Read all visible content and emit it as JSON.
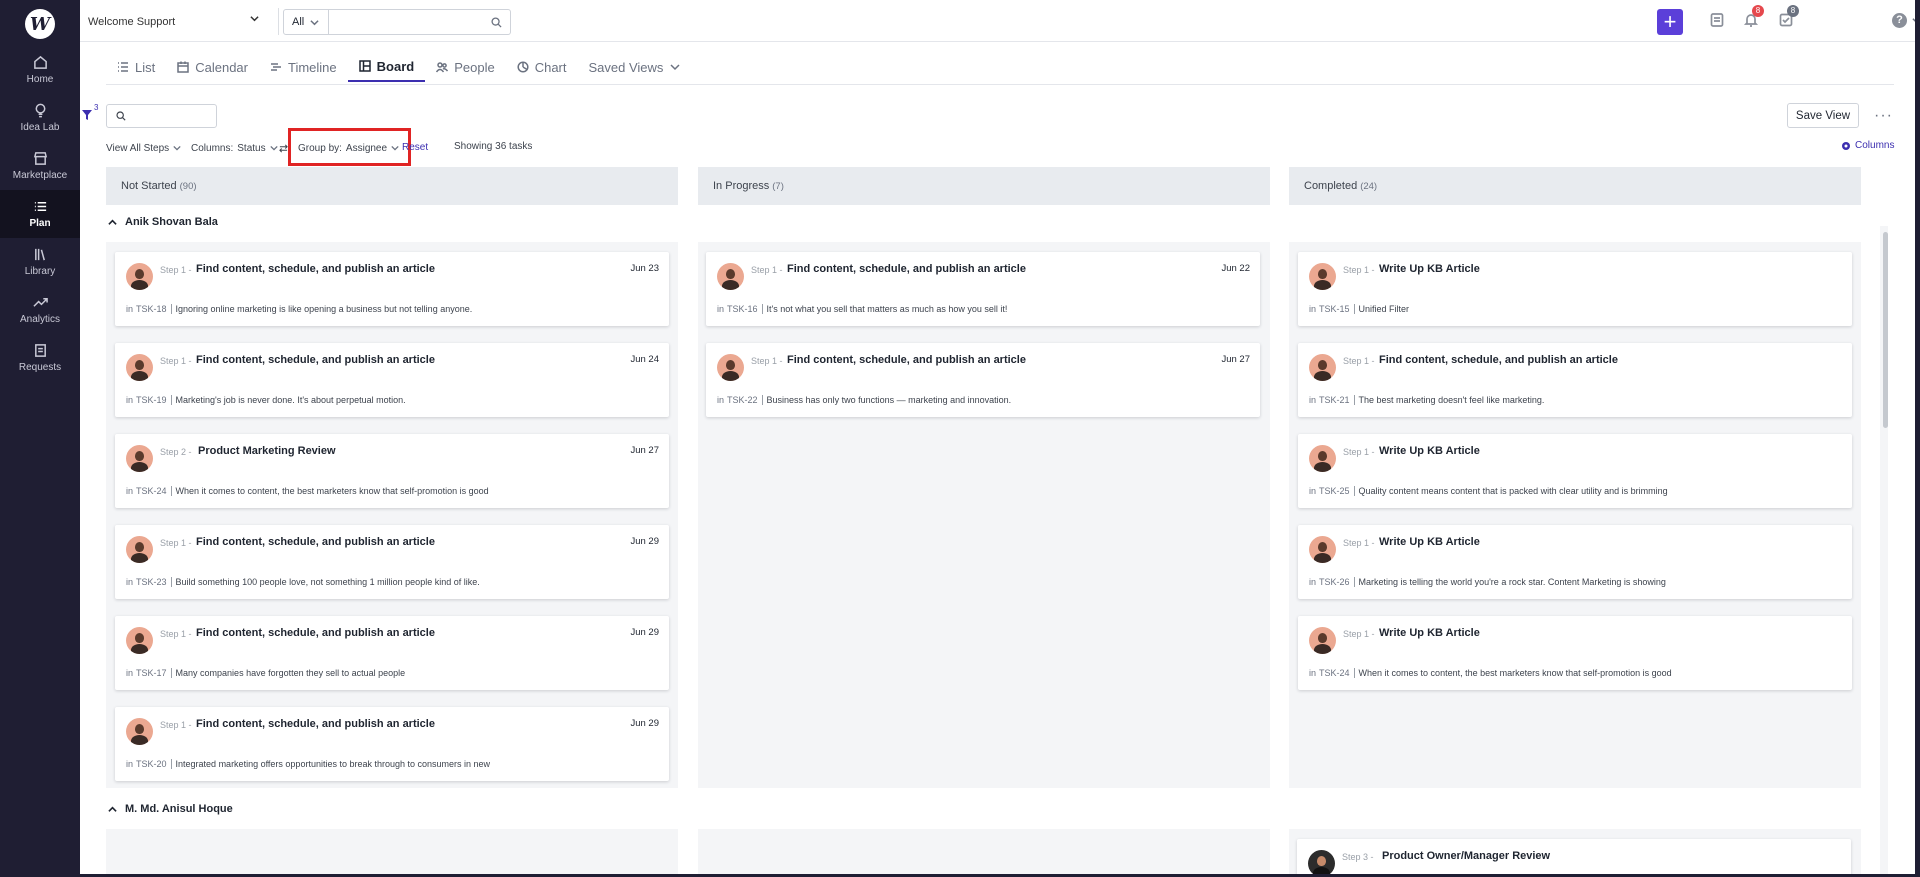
{
  "nav": {
    "logo_letter": "W",
    "items": [
      {
        "label": "Home",
        "icon": "home-icon"
      },
      {
        "label": "Idea Lab",
        "icon": "lightbulb-icon"
      },
      {
        "label": "Marketplace",
        "icon": "store-icon"
      },
      {
        "label": "Plan",
        "icon": "list-icon",
        "active": true
      },
      {
        "label": "Library",
        "icon": "library-icon"
      },
      {
        "label": "Analytics",
        "icon": "trend-icon"
      },
      {
        "label": "Requests",
        "icon": "request-icon"
      }
    ]
  },
  "topbar": {
    "workspace": "Welcome Support",
    "scope": "All",
    "search_placeholder": "",
    "notifications_count": "8",
    "tasks_count": "8"
  },
  "tabs": [
    {
      "label": "List",
      "icon": "list-icon"
    },
    {
      "label": "Calendar",
      "icon": "calendar-icon"
    },
    {
      "label": "Timeline",
      "icon": "timeline-icon"
    },
    {
      "label": "Board",
      "icon": "board-icon",
      "active": true
    },
    {
      "label": "People",
      "icon": "people-icon"
    },
    {
      "label": "Chart",
      "icon": "pie-chart-icon"
    },
    {
      "label": "Saved Views",
      "icon": "chevron-down-icon"
    }
  ],
  "toolbar": {
    "filter_count": "3",
    "search_placeholder": "",
    "save_view": "Save View",
    "view_all_steps": "View All Steps",
    "columns_label": "Columns:",
    "columns_value": "Status",
    "group_label": "Group by:",
    "group_value": "Assignee",
    "reset": "Reset",
    "showing": "Showing 36 tasks",
    "columns_link": "Columns"
  },
  "columns": [
    {
      "name": "Not Started",
      "count": "(90)"
    },
    {
      "name": "In Progress",
      "count": "(7)"
    },
    {
      "name": "Completed",
      "count": "(24)"
    }
  ],
  "groups": [
    {
      "name": "Anik Shovan Bala",
      "not_started": [
        {
          "step": "Step 1 -",
          "title": "Find content, schedule, and publish an article",
          "date": "Jun 23",
          "in": "in",
          "task": "TSK-18",
          "desc": "Ignoring online marketing is like opening a business but not telling anyone."
        },
        {
          "step": "Step 1 -",
          "title": "Find content, schedule, and publish an article",
          "date": "Jun 24",
          "in": "in",
          "task": "TSK-19",
          "desc": "Marketing's job is never done. It's about perpetual motion."
        },
        {
          "step": "Step 2 -",
          "title": "Product Marketing Review",
          "date": "Jun 27",
          "in": "in",
          "task": "TSK-24",
          "desc": "When it comes to content, the best marketers know that self-promotion is good"
        },
        {
          "step": "Step 1 -",
          "title": "Find content, schedule, and publish an article",
          "date": "Jun 29",
          "in": "in",
          "task": "TSK-23",
          "desc": "Build something 100 people love, not something 1 million people kind of like."
        },
        {
          "step": "Step 1 -",
          "title": "Find content, schedule, and publish an article",
          "date": "Jun 29",
          "in": "in",
          "task": "TSK-17",
          "desc": "Many companies have forgotten they sell to actual people"
        },
        {
          "step": "Step 1 -",
          "title": "Find content, schedule, and publish an article",
          "date": "Jun 29",
          "in": "in",
          "task": "TSK-20",
          "desc": "Integrated marketing offers opportunities to break through to consumers in new"
        }
      ],
      "in_progress": [
        {
          "step": "Step 1 -",
          "title": "Find content, schedule, and publish an article",
          "date": "Jun 22",
          "in": "in",
          "task": "TSK-16",
          "desc": "It's not what you sell that matters as much as how you sell it!"
        },
        {
          "step": "Step 1 -",
          "title": "Find content, schedule, and publish an article",
          "date": "Jun 27",
          "in": "in",
          "task": "TSK-22",
          "desc": "Business has only two functions — marketing and innovation."
        }
      ],
      "completed": [
        {
          "step": "Step 1 -",
          "title": "Write Up KB Article",
          "date": "",
          "in": "in",
          "task": "TSK-15",
          "desc": "Unified Filter"
        },
        {
          "step": "Step 1 -",
          "title": "Find content, schedule, and publish an article",
          "date": "",
          "in": "in",
          "task": "TSK-21",
          "desc": "The best marketing doesn't feel like marketing."
        },
        {
          "step": "Step 1 -",
          "title": "Write Up KB Article",
          "date": "",
          "in": "in",
          "task": "TSK-25",
          "desc": "Quality content means content that is packed with clear utility and is brimming"
        },
        {
          "step": "Step 1 -",
          "title": "Write Up KB Article",
          "date": "",
          "in": "in",
          "task": "TSK-26",
          "desc": "Marketing is telling the world you're a rock star. Content Marketing is showing"
        },
        {
          "step": "Step 1 -",
          "title": "Write Up KB Article",
          "date": "",
          "in": "in",
          "task": "TSK-24",
          "desc": "When it comes to content, the best marketers know that self-promotion is good"
        }
      ]
    },
    {
      "name": "M. Md. Anisul Hoque",
      "completed": [
        {
          "step": "Step 3 -",
          "title": "Product Owner/Manager Review"
        }
      ]
    }
  ]
}
